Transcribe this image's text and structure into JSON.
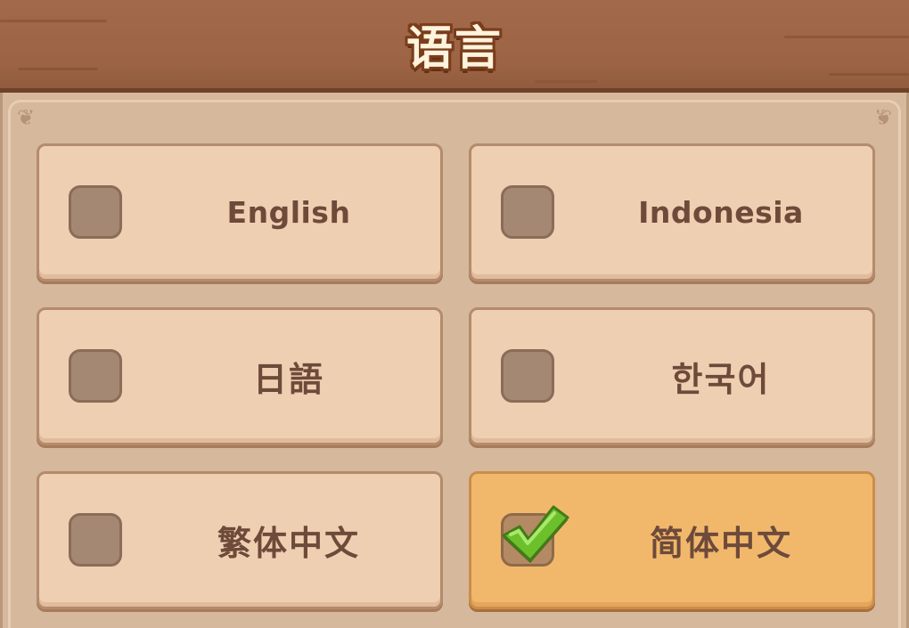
{
  "header": {
    "title": "语言"
  },
  "languages": [
    {
      "label": "English",
      "selected": false
    },
    {
      "label": "Indonesia",
      "selected": false
    },
    {
      "label": "日語",
      "selected": false
    },
    {
      "label": "한국어",
      "selected": false
    },
    {
      "label": "繁体中文",
      "selected": false
    },
    {
      "label": "简体中文",
      "selected": true
    }
  ],
  "colors": {
    "option_default": "#eecfb2",
    "option_selected": "#f1b86c",
    "checkmark": "#6cc02c",
    "label_text": "#6e4a3a",
    "header_wood": "#9c6444"
  },
  "icons": {
    "checkmark": "green-checkmark-icon"
  }
}
